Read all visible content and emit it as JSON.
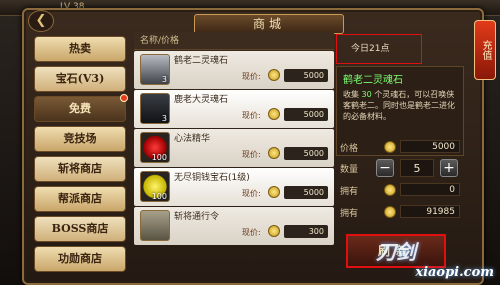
{
  "status": {
    "level": "LV 38"
  },
  "window": {
    "title": "商城",
    "back_glyph": "❮"
  },
  "side_tab": {
    "label": "充值"
  },
  "menu": {
    "items": [
      {
        "label": "热卖"
      },
      {
        "label": "宝石(V3)"
      },
      {
        "label": "免费",
        "badge": true
      },
      {
        "label": "竞技场"
      },
      {
        "label": "斩将商店"
      },
      {
        "label": "帮派商店"
      },
      {
        "label": "BOSS商店"
      },
      {
        "label": "功勋商店"
      }
    ]
  },
  "list": {
    "header": "名称/价格",
    "price_label": "现价:",
    "rows": [
      {
        "name": "鹤老二灵魂石",
        "qty": "3",
        "price": "5000",
        "icon": "char-portrait-icon"
      },
      {
        "name": "鹿老大灵魂石",
        "qty": "3",
        "price": "5000",
        "icon": "char-portrait-icon"
      },
      {
        "name": "心法精华",
        "qty": "100",
        "price": "5000",
        "icon": "red-gem-icon"
      },
      {
        "name": "无尽铜钱宝石(1级)",
        "qty": "100",
        "price": "5000",
        "icon": "yellow-gem-icon"
      },
      {
        "name": "斩将通行令",
        "qty": "",
        "price": "300",
        "icon": "token-icon"
      }
    ]
  },
  "detail": {
    "time": "今日21点",
    "item_name": "鹤老二灵魂石",
    "desc_pre": "收集",
    "desc_num": "30",
    "desc_post": "个灵魂石，可以召唤侠客鹤老二。同时也是鹤老二进化的必备材料。",
    "price_label": "价格",
    "price_value": "5000",
    "qty_label": "数量",
    "qty_value": "5",
    "own1_label": "拥有",
    "own1_value": "0",
    "own2_label": "拥有",
    "own2_value": "91985",
    "buy_label": "刷新"
  },
  "watermark": {
    "main": "刀剑",
    "sub": "xiaopi.com"
  }
}
